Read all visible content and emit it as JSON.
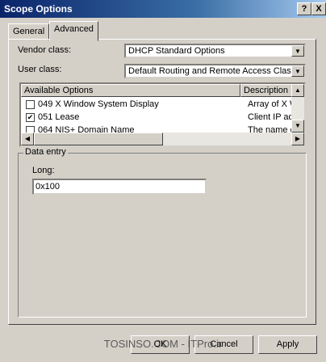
{
  "window": {
    "title": "Scope Options",
    "help_btn": "?",
    "close_btn": "X"
  },
  "tabs": [
    {
      "label": "General"
    },
    {
      "label": "Advanced"
    }
  ],
  "vendor": {
    "label": "Vendor class:",
    "value": "DHCP Standard Options"
  },
  "user": {
    "label": "User class:",
    "value": "Default Routing and Remote Access Class"
  },
  "options_list": {
    "columns": [
      "Available Options",
      "Description"
    ],
    "rows": [
      {
        "checked": false,
        "name": "049 X Window System Display",
        "desc": "Array of X W"
      },
      {
        "checked": true,
        "name": "051 Lease",
        "desc": "Client IP add"
      },
      {
        "checked": false,
        "name": "064 NIS+ Domain Name",
        "desc": "The name o"
      }
    ]
  },
  "data_entry": {
    "legend": "Data entry",
    "field_label": "Long:",
    "value": "0x100"
  },
  "buttons": {
    "ok": "OK",
    "cancel": "Cancel",
    "apply": "Apply"
  },
  "watermark": "TOSINSO.COM - ITPro.ir"
}
